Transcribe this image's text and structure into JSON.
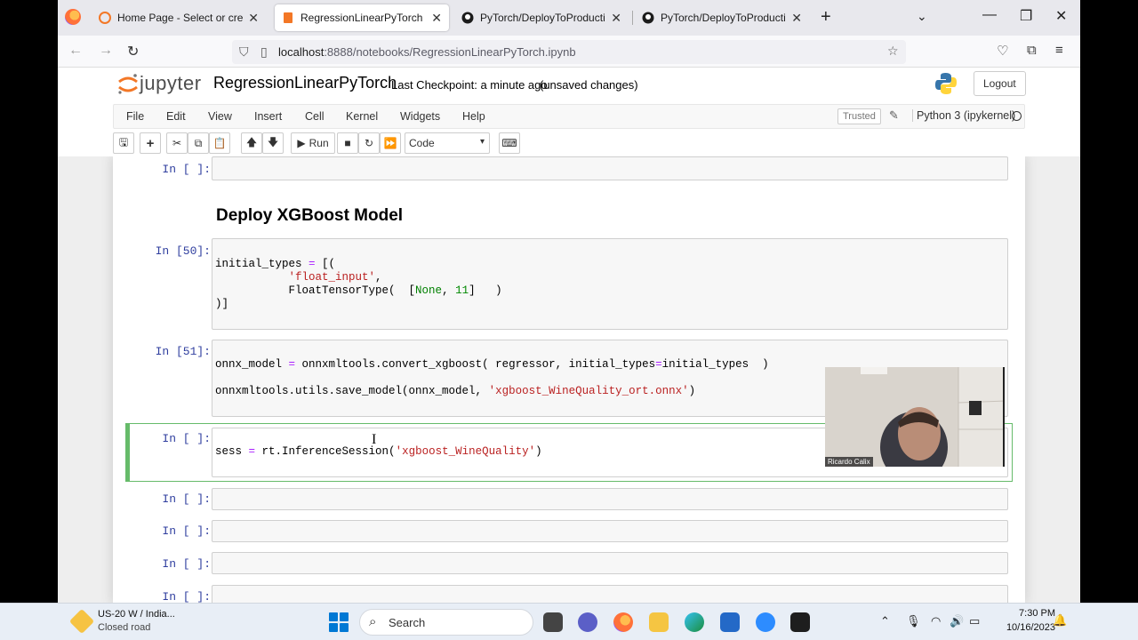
{
  "browser": {
    "tabs": [
      {
        "label": "Home Page - Select or create a",
        "icon": "jupyter-tab-icon",
        "active": false
      },
      {
        "label": "RegressionLinearPyTorch - Jupy",
        "icon": "jupyter-tab-icon",
        "active": true
      },
      {
        "label": "PyTorch/DeployToProduction/S",
        "icon": "github-icon",
        "active": false
      },
      {
        "label": "PyTorch/DeployToProduction at",
        "icon": "github-icon",
        "active": false
      }
    ],
    "url_host": "localhost",
    "url_path": ":8888/notebooks/RegressionLinearPyTorch.ipynb"
  },
  "jupyter": {
    "logo_text": "jupyter",
    "notebook_name": "RegressionLinearPyTorch",
    "checkpoint": "Last Checkpoint: a minute ago",
    "unsaved": "(unsaved changes)",
    "logout": "Logout",
    "menu": [
      "File",
      "Edit",
      "View",
      "Insert",
      "Cell",
      "Kernel",
      "Widgets",
      "Help"
    ],
    "trusted": "Trusted",
    "kernel_name": "Python 3 (ipykernel)",
    "toolbar": {
      "run_label": "Run",
      "cell_type": "Code"
    }
  },
  "cells": {
    "c0_prompt": "In [ ]:",
    "heading": "Deploy XGBoost Model",
    "c1_prompt": "In [50]:",
    "c1_lines": [
      "initial_types = [(",
      "           'float_input',",
      "           FloatTensorType(  [None, 11]   )",
      ")]"
    ],
    "c2_prompt": "In [51]:",
    "c2_line1": "onnx_model = onnxmltools.convert_xgboost( regressor, initial_types=initial_types  )",
    "c2_line2": "onnxmltools.utils.save_model(onnx_model, 'xgboost_WineQuality_ort.onnx')",
    "c3_prompt": "In [ ]:",
    "c3_line": "sess = rt.InferenceSession('xgboost_WineQuality')",
    "c4_prompt": "In [ ]:",
    "c5_prompt": "In [ ]:",
    "c6_prompt": "In [ ]:",
    "c7_prompt": "In [ ]:"
  },
  "webcam": {
    "name": "Ricardo Calix"
  },
  "taskbar": {
    "weather_line1": "US-20 W / India...",
    "weather_line2": "Closed road",
    "search": "Search",
    "time": "7:30 PM",
    "date": "10/16/2023"
  }
}
